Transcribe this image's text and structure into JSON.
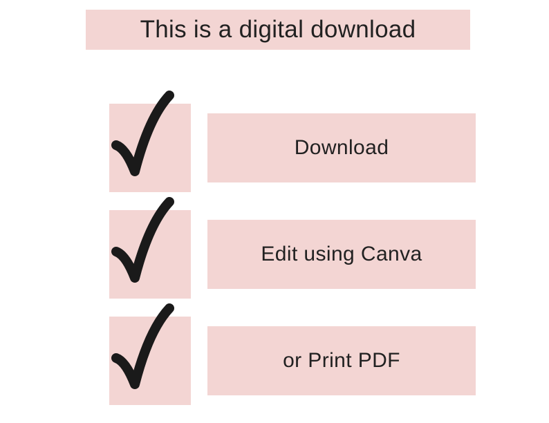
{
  "colors": {
    "pink": "#f3d5d3",
    "text": "#212121"
  },
  "header": {
    "title": "This is a digital download"
  },
  "items": [
    {
      "icon": "checkmark",
      "label": "Download"
    },
    {
      "icon": "checkmark",
      "label": "Edit using Canva"
    },
    {
      "icon": "checkmark",
      "label": "or Print PDF"
    }
  ]
}
